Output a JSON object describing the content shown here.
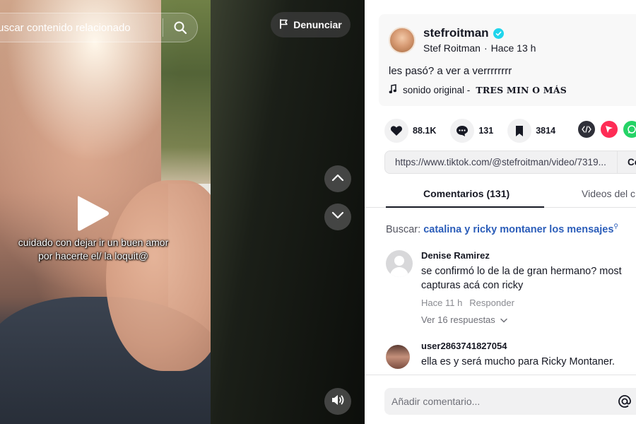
{
  "video": {
    "search_placeholder": "uscar contenido relacionado",
    "report_label": "Denunciar",
    "caption": "cuidado con dejar ir un buen amor por hacerte el/ la loquit@"
  },
  "post": {
    "username": "stefroitman",
    "display_name": "Stef Roitman",
    "separator": "·",
    "time": "Hace 13 h",
    "text": "les pasó? a ver a verrrrrrrr",
    "sound_prefix": "sonido original -",
    "sound_title": "TRES MIN O MÁS"
  },
  "stats": {
    "likes": "88.1K",
    "comments": "131",
    "saves": "3814"
  },
  "share": {
    "link": "https://www.tiktok.com/@stefroitman/video/7319...",
    "copy_label": "Co"
  },
  "tabs": {
    "comments": "Comentarios (131)",
    "videos": "Videos del c"
  },
  "search_suggestion": {
    "label": "Buscar:",
    "term": "catalina y ricky montaner los mensajes"
  },
  "comments": [
    {
      "user": "Denise Ramirez",
      "text": "se confirmó lo de la de gran hermano? most capturas acá con ricky",
      "time": "Hace 11 h",
      "reply": "Responder",
      "replies": "Ver 16 respuestas"
    },
    {
      "user": "user2863741827054",
      "text": "ella es y será mucho para Ricky Montaner."
    }
  ],
  "input": {
    "placeholder": "Añadir comentario..."
  },
  "colors": {
    "accent": "#fe2c55",
    "verified": "#20d5ec",
    "link_blue": "#2b5db9"
  }
}
